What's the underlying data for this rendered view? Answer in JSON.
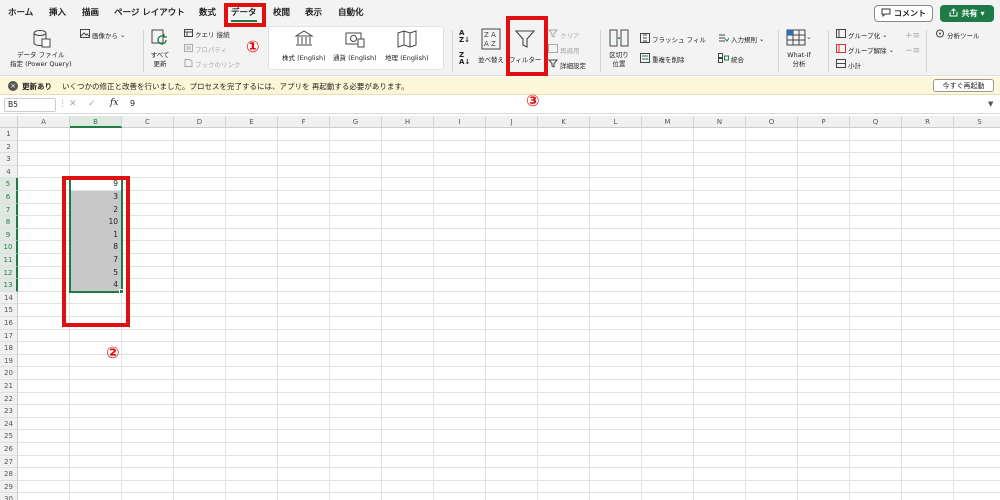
{
  "menu": {
    "tabs": [
      "ホーム",
      "挿入",
      "描画",
      "ページ レイアウト",
      "数式",
      "データ",
      "校閲",
      "表示",
      "自動化"
    ],
    "active_tab": "データ",
    "comment_label": "コメント",
    "share_label": "共有"
  },
  "ribbon": {
    "get_data_line1": "データ ファイル",
    "get_data_line2": "指定 (Power Query)",
    "from_image": "画像から",
    "refresh_line1": "すべて",
    "refresh_line2": "更新",
    "query_connections": "クエリ  接続",
    "properties": "プロパティ",
    "edit_links": "ブックのリンク",
    "datatype_stocks": "株式 (English)",
    "datatype_currencies": "通貨 (English)",
    "datatype_geography": "地理 (English)",
    "sort": "並べ替え",
    "filter": "フィルター",
    "clear": "クリア",
    "reapply": "再適用",
    "advanced": "詳細設定",
    "text_to_columns_line1": "区切り",
    "text_to_columns_line2": "位置",
    "flash_fill": "フラッシュ フィル",
    "remove_duplicates": "重複を削除",
    "data_validation": "入力規則",
    "consolidate": "統合",
    "whatif_line1": "What-If",
    "whatif_line2": "分析",
    "group": "グループ化",
    "ungroup": "グループ解除",
    "subtotal": "小計",
    "analysis_tools": "分析ツール"
  },
  "infobar": {
    "title": "更新あり",
    "message": "いくつかの修正と改善を行いました。プロセスを完了するには、アプリを 再起動する必要があります。",
    "restart_button": "今すぐ再起動"
  },
  "formula_bar": {
    "cell_ref": "B5",
    "fx": "fx",
    "value": "9"
  },
  "sheet": {
    "columns": [
      "A",
      "B",
      "C",
      "D",
      "E",
      "F",
      "G",
      "H",
      "I",
      "J",
      "K",
      "L",
      "M",
      "N",
      "O",
      "P",
      "Q",
      "R",
      "S"
    ],
    "rows": [
      "1",
      "2",
      "3",
      "4",
      "5",
      "6",
      "7",
      "8",
      "9",
      "10",
      "11",
      "12",
      "13",
      "14",
      "15",
      "16",
      "17",
      "18",
      "19",
      "20",
      "21",
      "22",
      "23",
      "24",
      "25",
      "26",
      "27",
      "28",
      "29",
      "30"
    ],
    "selected_column": "B",
    "selected_rows": [
      "5",
      "6",
      "7",
      "8",
      "9",
      "10",
      "11",
      "12",
      "13"
    ],
    "column_b_values": [
      "9",
      "3",
      "2",
      "10",
      "1",
      "8",
      "7",
      "5",
      "4"
    ]
  },
  "annotations": {
    "step1": "①",
    "step2": "②",
    "step3": "③",
    "color": "#e01010"
  },
  "icons": {
    "get_data": "database-icon",
    "refresh": "refresh-icon",
    "stocks": "bank-icon",
    "currencies": "money-icon",
    "geography": "map-icon",
    "sort_az": "sort-az-icon",
    "sort_za": "sort-za-icon",
    "filter": "funnel-icon",
    "what_if": "table-icon"
  },
  "colors": {
    "accent": "#1e7b45",
    "annotation": "#e01010",
    "infobar_bg": "#fdf6d8",
    "selection_fill": "#c8c8c8"
  }
}
